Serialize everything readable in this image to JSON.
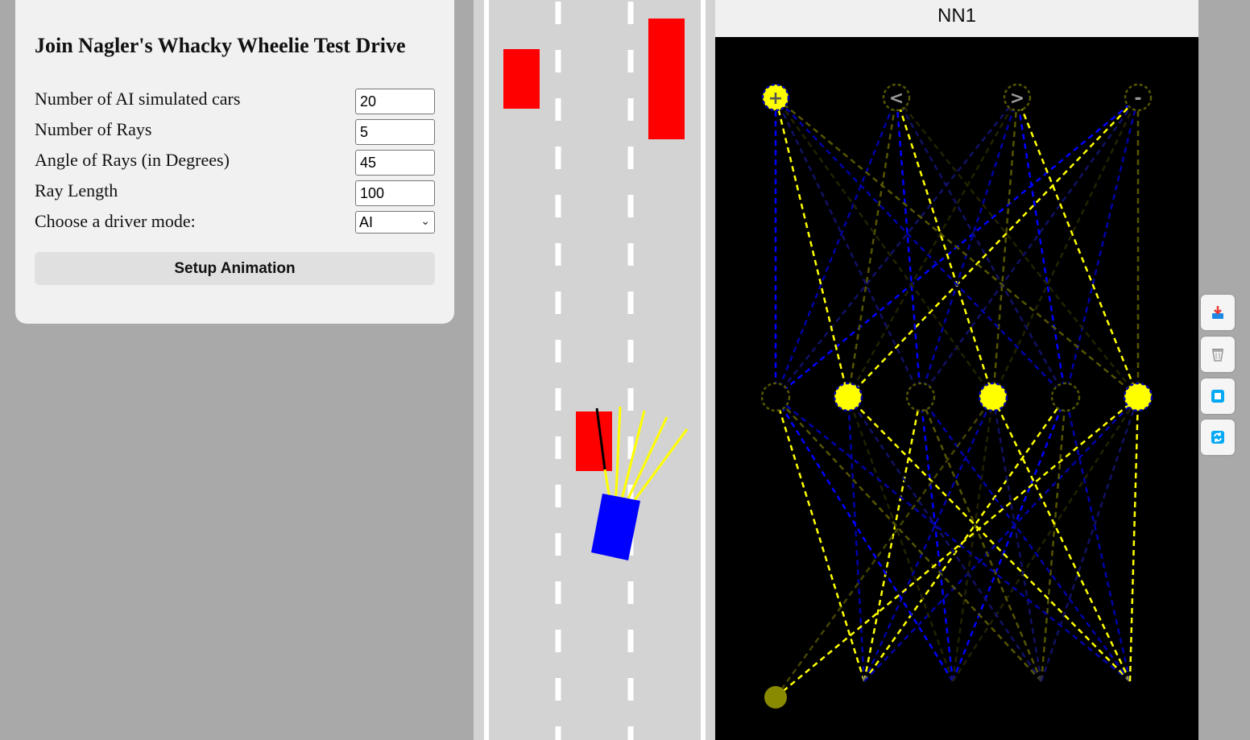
{
  "settings": {
    "title": "Join Nagler's Whacky Wheelie Test Drive",
    "fields": {
      "num_cars": {
        "label": "Number of AI simulated cars",
        "value": "20"
      },
      "num_rays": {
        "label": "Number of Rays",
        "value": "5"
      },
      "ray_angle": {
        "label": "Angle of Rays (in Degrees)",
        "value": "45"
      },
      "ray_length": {
        "label": "Ray Length",
        "value": "100"
      },
      "driver_mode": {
        "label": "Choose a driver mode:",
        "value": "AI",
        "options": [
          "AI"
        ]
      }
    },
    "setup_button": "Setup Animation"
  },
  "network": {
    "title": "NN1",
    "output_labels": [
      "+",
      "<",
      ">",
      "-"
    ],
    "output_active": [
      true,
      false,
      false,
      false
    ],
    "hidden_active": [
      false,
      true,
      false,
      true,
      false,
      true
    ]
  },
  "colors": {
    "background": "#a9a9a9",
    "road": "#d3d3d3",
    "traffic": "#ff0000",
    "player": "#0000ff",
    "sensor": "#ffff00",
    "node_active": "#ffff00"
  },
  "toolbar": {
    "icons": [
      "save-icon",
      "trash-icon",
      "square-icon",
      "refresh-icon"
    ]
  }
}
